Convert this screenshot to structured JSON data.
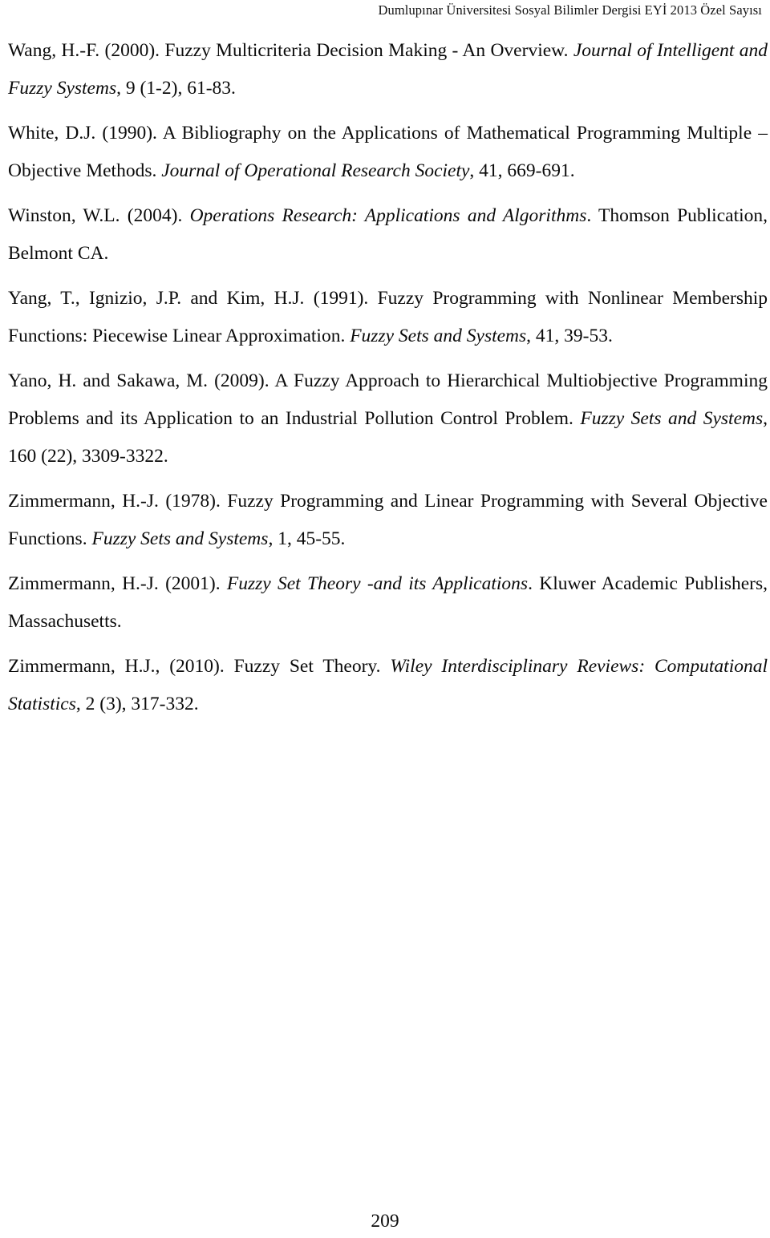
{
  "page": {
    "running_head": "Dumlupınar Üniversitesi Sosyal Bilimler Dergisi EYİ 2013 Özel Sayısı",
    "folio": "209",
    "section": "references"
  },
  "references": [
    {
      "id": "wang-2000",
      "text": "Wang, H.-F. (2000). Fuzzy Multicriteria Decision Making - An Overview. Journal of Intelligent and Fuzzy Systems, 9 (1-2), 61-83.",
      "author": "Wang, H.-F.",
      "year": "(2000)",
      "title": "Fuzzy Multicriteria Decision Making - An Overview.",
      "source": "Journal of Intelligent and Fuzzy Systems",
      "volume_issue_pages": ", 9 (1-2), 61-83."
    },
    {
      "id": "white-1990",
      "text": "White, D.J. (1990). A Bibliography on the Applications of Mathematical Programming Multiple – Objective Methods. Journal of Operational Research Society, 41, 669-691.",
      "author": "White, D.J.",
      "year": "(1990)",
      "title": "A Bibliography on the Applications of Mathematical Programming Multiple – Objective Methods.",
      "source": "Journal of Operational Research Society",
      "volume_issue_pages": ", 41, 669-691."
    },
    {
      "id": "winston-2004",
      "text": "Winston, W.L. (2004). Operations Research: Applications and Algorithms. Thomson Publication, Belmont CA.",
      "author": "Winston, W.L.",
      "year": "(2004)",
      "source": "Operations Research: Applications and Algorithms",
      "publisher": ". Thomson Publication, Belmont CA."
    },
    {
      "id": "yang-1991",
      "text": "Yang, T., Ignizio, J.P. and Kim, H.J. (1991). Fuzzy Programming with Nonlinear Membership Functions: Piecewise Linear Approximation. Fuzzy Sets and Systems, 41, 39-53.",
      "author": "Yang, T., Ignizio, J.P. and Kim, H.J.",
      "year": "(1991)",
      "title": "Fuzzy Programming with Nonlinear Membership Functions: Piecewise Linear Approximation.",
      "source": "Fuzzy Sets and Systems",
      "volume_issue_pages": ", 41, 39-53."
    },
    {
      "id": "yano-sakawa-2009",
      "text": "Yano, H. and Sakawa, M. (2009). A Fuzzy Approach to Hierarchical Multiobjective Programming Problems and its Application to an Industrial Pollution Control Problem. Fuzzy Sets and Systems, 160 (22), 3309-3322.",
      "author": "Yano, H. and Sakawa, M.",
      "year": "(2009)",
      "title": "A Fuzzy Approach to Hierarchical Multiobjective Programming Problems and its Application to an Industrial Pollution Control Problem.",
      "source": "Fuzzy Sets and Systems",
      "volume_issue_pages": ", 160 (22), 3309-3322."
    },
    {
      "id": "zimmermann-1978",
      "text": "Zimmermann, H.-J. (1978). Fuzzy Programming and Linear Programming with Several Objective Functions. Fuzzy Sets and Systems, 1, 45-55.",
      "author": "Zimmermann, H.-J.",
      "year": "(1978)",
      "title": "Fuzzy Programming and Linear Programming with Several Objective Functions.",
      "source": "Fuzzy Sets and Systems",
      "volume_issue_pages": ", 1, 45-55."
    },
    {
      "id": "zimmermann-2001",
      "text": "Zimmermann, H.-J. (2001). Fuzzy Set Theory -and its Applications. Kluwer Academic Publishers, Massachusetts.",
      "author": "Zimmermann, H.-J.",
      "year": "(2001)",
      "source": "Fuzzy Set Theory -and its Applications",
      "publisher": ". Kluwer Academic Publishers, Massachusetts."
    },
    {
      "id": "zimmermann-2010",
      "text": "Zimmermann, H.J., (2010). Fuzzy Set Theory. Wiley Interdisciplinary Reviews: Computational Statistics, 2 (3), 317-332.",
      "author": "Zimmermann, H.J.,",
      "year": "(2010)",
      "title": "Fuzzy Set Theory.",
      "source": "Wiley Interdisciplinary Reviews: Computational Statistics",
      "volume_issue_pages": ", 2 (3), 317-332."
    }
  ]
}
